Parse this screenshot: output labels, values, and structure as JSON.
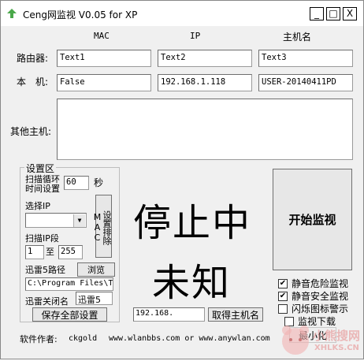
{
  "window": {
    "title": "Ceng网监视 V0.05 for XP",
    "controls": {
      "minimize": "_",
      "maximize": "□",
      "close": "X"
    }
  },
  "columns": {
    "mac": "MAC",
    "ip": "IP",
    "hostname": "主机名"
  },
  "router": {
    "label": "路由器:",
    "mac": "Text1",
    "ip": "Text2",
    "hostname": "Text3"
  },
  "local": {
    "label": "本　机:",
    "mac": "False",
    "ip": "192.168.1.118",
    "hostname": "USER-20140411PD"
  },
  "others": {
    "label": "其他主机:"
  },
  "settings": {
    "title": "设置区",
    "scan_cycle_label_1": "扫描循环",
    "scan_cycle_label_2": "时间设置",
    "scan_cycle_value": "60",
    "scan_cycle_unit": "秒",
    "choose_ip_label": "选择IP",
    "choose_ip_value": "",
    "set_exclude_mac_label": "设置排除MAC",
    "scan_ip_range_label": "扫描IP段",
    "ip_from": "1",
    "ip_to_label": "至",
    "ip_to": "255",
    "thunder_path_label": "迅雷5路径",
    "browse_label": "浏览",
    "thunder_path_value": "C:\\Program Files\\T",
    "thunder_close_name_label": "迅雷关闭名",
    "thunder_close_name_value": "迅雷5",
    "save_all_label": "保存全部设置"
  },
  "status": {
    "line1": "停止中",
    "line2": "未知"
  },
  "host_query": {
    "ip_value": "192.168.",
    "get_hostname_label": "取得主机名"
  },
  "start_button_label": "开始监视",
  "options": [
    {
      "label": "静音危险监视",
      "checked": true
    },
    {
      "label": "静音安全监视",
      "checked": true
    },
    {
      "label": "闪烁图标警示",
      "checked": false
    },
    {
      "label": "监视下载",
      "checked": false
    }
  ],
  "minimize_label": "最小化",
  "footer": {
    "author_label": "软件作者:",
    "author": "ckgold",
    "sites": "www.wlanbbs.com or www.anywlan.com"
  },
  "watermark": {
    "text_cn": "小熊搜网",
    "text_en": "XHLKS.CN"
  }
}
